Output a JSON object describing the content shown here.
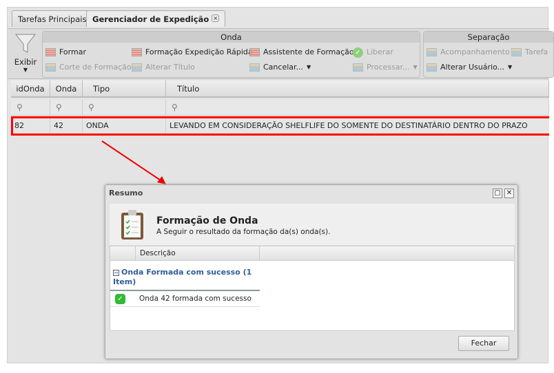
{
  "tabs": [
    {
      "label": "Tarefas Principais"
    },
    {
      "label": "Gerenciador de Expedição",
      "close": "×"
    }
  ],
  "toolbar": {
    "exibir": "Exibir",
    "onda": {
      "title": "Onda",
      "formar": "Formar",
      "formacao_rapida": "Formação Expedição Rápida",
      "assistente": "Assistente de Formação",
      "liberar": "Liberar",
      "corte": "Corte de Formação",
      "alterar_titulo": "Alterar Título",
      "cancelar": "Cancelar...",
      "processar": "Processar..."
    },
    "separacao": {
      "title": "Separação",
      "acompanhamento": "Acompanhamento",
      "tarefa": "Tarefa",
      "alterar_usuario": "Alterar Usuário..."
    }
  },
  "grid": {
    "columns": [
      "idOnda",
      "Onda",
      "Tipo",
      "Título"
    ],
    "rows": [
      [
        "82",
        "42",
        "ONDA",
        "LEVANDO EM CONSIDERAÇÃO SHELFLIFE DO SOMENTE DO DESTINATÁRIO DENTRO DO PRAZO"
      ]
    ]
  },
  "dialog": {
    "title": "Resumo",
    "heading": "Formação de Onda",
    "subheading": "A Seguir o resultado da formação da(s) onda(s).",
    "column": "Descrição",
    "group": "Onda Formada com sucesso (1 Item)",
    "item": "Onda 42 formada com sucesso",
    "close_button": "Fechar"
  },
  "colors": {
    "highlight": "#ff0000",
    "group_text": "#2f5d9a"
  }
}
